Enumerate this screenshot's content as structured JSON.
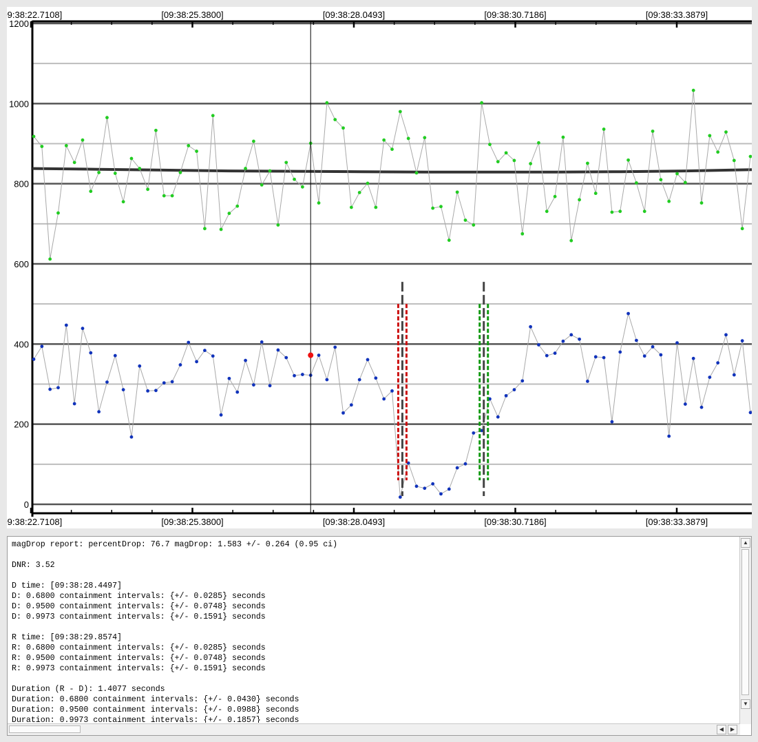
{
  "chart_data": {
    "type": "line",
    "xaxis": {
      "tick_labels": [
        "[09:38:22.7108]",
        "[09:38:25.3800]",
        "[09:38:28.0493]",
        "[09:38:30.7186]",
        "[09:38:33.3879]"
      ],
      "range": [
        0,
        125
      ]
    },
    "yaxis": {
      "range": [
        0,
        1200
      ],
      "tick_labels": [
        "0",
        "200",
        "400",
        "600",
        "800",
        "1000",
        "1200"
      ],
      "major_grid": [
        0,
        200,
        400,
        600,
        800,
        1000,
        1200
      ],
      "minor_grid": [
        100,
        300,
        500,
        700,
        900,
        1100
      ]
    },
    "grid": true,
    "cursor_index": 34,
    "series": [
      {
        "color": "#22cc22",
        "values": [
          918,
          893,
          612,
          727,
          895,
          853,
          909,
          781,
          828,
          965,
          826,
          755,
          863,
          838,
          786,
          933,
          770,
          770,
          828,
          895,
          881,
          688,
          970,
          686,
          726,
          744,
          838,
          906,
          797,
          832,
          697,
          853,
          811,
          792,
          901,
          752,
          1002,
          960,
          939,
          741,
          778,
          801,
          741,
          909,
          886,
          980,
          913,
          827,
          915,
          739,
          743,
          659,
          779,
          709,
          697,
          1002,
          898,
          855,
          877,
          858,
          675,
          850,
          902,
          731,
          768,
          916,
          658,
          760,
          851,
          776,
          936,
          729,
          731,
          859,
          802,
          731,
          931,
          810,
          756,
          825,
          803,
          1033,
          752,
          920,
          879,
          929,
          858,
          688,
          868
        ]
      },
      {
        "color": "#1133bb",
        "values": [
          362,
          394,
          287,
          291,
          447,
          251,
          439,
          378,
          231,
          305,
          371,
          286,
          168,
          345,
          283,
          284,
          303,
          306,
          348,
          404,
          356,
          384,
          370,
          223,
          314,
          280,
          359,
          298,
          405,
          296,
          385,
          366,
          321,
          324,
          322,
          372,
          311,
          392,
          228,
          248,
          311,
          361,
          315,
          263,
          283,
          18,
          103,
          45,
          40,
          51,
          26,
          38,
          91,
          101,
          178,
          184,
          263,
          218,
          271,
          286,
          308,
          443,
          398,
          371,
          377,
          407,
          423,
          412,
          307,
          368,
          366,
          206,
          380,
          476,
          409,
          370,
          393,
          373,
          170,
          403,
          250,
          364,
          242,
          317,
          353,
          423,
          323,
          408,
          229,
          258
        ]
      }
    ],
    "baseline": {
      "color": "#333333",
      "values": [
        838,
        836,
        834,
        832,
        831,
        830,
        829,
        829,
        829,
        830,
        832,
        835
      ]
    },
    "d_marker": {
      "color": "#cc1111",
      "range": [
        0,
        500
      ]
    },
    "r_marker": {
      "color": "#119911",
      "range": [
        0,
        500
      ]
    },
    "marker_center_color": "#444444",
    "marker_center_range": [
      0,
      555
    ],
    "highlight_point": {
      "color": "#ee1111",
      "value": 372
    }
  },
  "report": {
    "lines": [
      "magDrop report: percentDrop: 76.7 magDrop: 1.583 +/- 0.264 (0.95 ci)",
      "",
      "DNR: 3.52",
      "",
      "D time: [09:38:28.4497]",
      "D: 0.6800 containment intervals: {+/- 0.0285} seconds",
      "D: 0.9500 containment intervals: {+/- 0.0748} seconds",
      "D: 0.9973 containment intervals: {+/- 0.1591} seconds",
      "",
      "R time: [09:38:29.8574]",
      "R: 0.6800 containment intervals: {+/- 0.0285} seconds",
      "R: 0.9500 containment intervals: {+/- 0.0748} seconds",
      "R: 0.9973 containment intervals: {+/- 0.1591} seconds",
      "",
      "Duration (R - D): 1.4077 seconds",
      "Duration: 0.6800 containment intervals: {+/- 0.0430} seconds",
      "Duration: 0.9500 containment intervals: {+/- 0.0988} seconds",
      "Duration: 0.9973 containment intervals: {+/- 0.1857} seconds"
    ]
  }
}
